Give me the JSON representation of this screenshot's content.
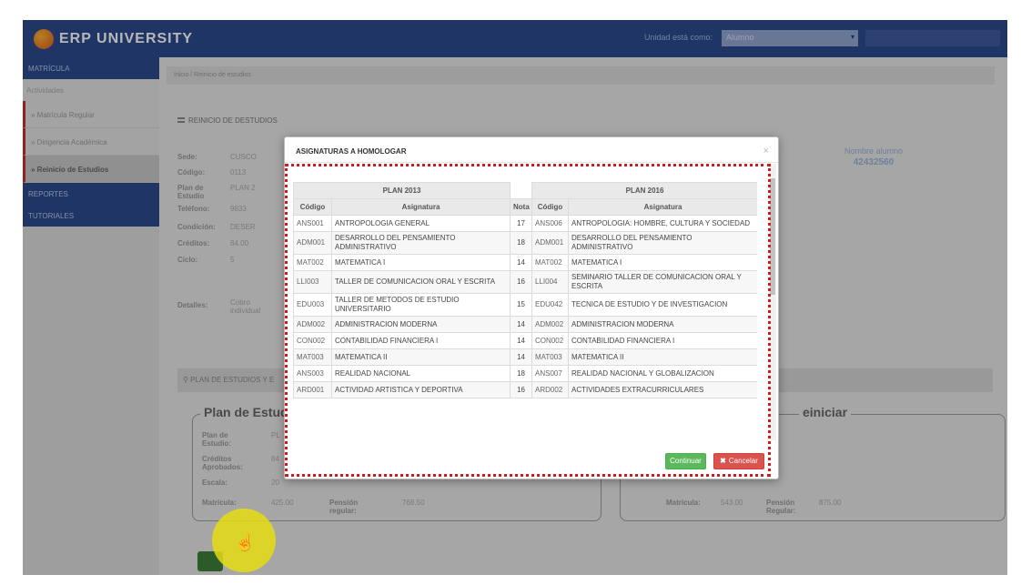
{
  "header": {
    "logo_text": "ERP UNIVERSITY",
    "logo_tag": "",
    "unit_label": "Unidad está como:",
    "unit_select_value": "Alumno",
    "colors": {
      "primary": "#2c4a8c",
      "accent": "#c9302c"
    }
  },
  "sidebar": {
    "section_matricula": "MATRÍCULA",
    "subsection": "Actividades",
    "items": [
      {
        "label": "» Matrícula Regular"
      },
      {
        "label": "» Dirigencia Académica"
      },
      {
        "label": "» Reinicio de Estudios"
      }
    ],
    "section_reportes": "REPORTES",
    "section_tutoriales": "TUTORIALES"
  },
  "main": {
    "breadcrumb": "Inicio  /  Reinicio de estudios",
    "page_title": "REINICIO DE DESTUDIOS",
    "fields": [
      {
        "label": "Sede:",
        "value": "CUSCO"
      },
      {
        "label": "Código:",
        "value": "0113"
      },
      {
        "label": "Plan de Estudio",
        "value": "PLAN 2"
      },
      {
        "label": "Teléfono:",
        "value": "9833"
      },
      {
        "label": "Condición:",
        "value": "DESER"
      },
      {
        "label": "Créditos:",
        "value": "84.00"
      },
      {
        "label": "Ciclo:",
        "value": "5"
      },
      {
        "label": "Detalles:",
        "value": "Cobro individual"
      }
    ],
    "alumno_label": "Nombre alumno",
    "alumno_dni": "42432560",
    "plan_bar": "PLAN DE ESTUDIOS Y E",
    "left_fieldset": {
      "legend": "Plan de Estud",
      "rows": [
        {
          "label": "Plan de Estudio:",
          "value": "PL"
        },
        {
          "label": "Créditos Aprobados:",
          "value": "84"
        },
        {
          "label": "Escala:",
          "value": "20"
        },
        {
          "label": "Matrícula:",
          "value": "425.00"
        }
      ],
      "pension_label": "Pensión regular:",
      "pension_value": "768.50"
    },
    "right_fieldset": {
      "legend": "einiciar",
      "matricula_label": "Matrícula:",
      "matricula_value": "543.00",
      "pension_label": "Pensión Regular:",
      "pension_value": "875.00"
    }
  },
  "modal": {
    "title": "ASIGNATURAS A HOMOLOGAR",
    "close": "×",
    "plan_left": "PLAN 2013",
    "plan_right": "PLAN 2016",
    "columns": [
      "Código",
      "Asignatura",
      "Nota",
      "Código",
      "Asignatura"
    ],
    "rows": [
      {
        "c1": "ANS001",
        "a1": "ANTROPOLOGIA GENERAL",
        "nota": "17",
        "c2": "ANS006",
        "a2": "ANTROPOLOGIA: HOMBRE, CULTURA Y SOCIEDAD"
      },
      {
        "c1": "ADM001",
        "a1": "DESARROLLO DEL PENSAMIENTO ADMINISTRATIVO",
        "nota": "18",
        "c2": "ADM001",
        "a2": "DESARROLLO DEL PENSAMIENTO ADMINISTRATIVO"
      },
      {
        "c1": "MAT002",
        "a1": "MATEMATICA I",
        "nota": "14",
        "c2": "MAT002",
        "a2": "MATEMATICA I"
      },
      {
        "c1": "LLI003",
        "a1": "TALLER DE COMUNICACION ORAL Y ESCRITA",
        "nota": "16",
        "c2": "LLI004",
        "a2": "SEMINARIO TALLER DE COMUNICACION ORAL Y ESCRITA"
      },
      {
        "c1": "EDU003",
        "a1": "TALLER DE METODOS DE ESTUDIO UNIVERSITARIO",
        "nota": "15",
        "c2": "EDU042",
        "a2": "TECNICA DE ESTUDIO Y DE INVESTIGACION"
      },
      {
        "c1": "ADM002",
        "a1": "ADMINISTRACION MODERNA",
        "nota": "14",
        "c2": "ADM002",
        "a2": "ADMINISTRACION MODERNA"
      },
      {
        "c1": "CON002",
        "a1": "CONTABILIDAD FINANCIERA I",
        "nota": "14",
        "c2": "CON002",
        "a2": "CONTABILIDAD FINANCIERA I"
      },
      {
        "c1": "MAT003",
        "a1": "MATEMATICA II",
        "nota": "14",
        "c2": "MAT003",
        "a2": "MATEMATICA II"
      },
      {
        "c1": "ANS003",
        "a1": "REALIDAD NACIONAL",
        "nota": "18",
        "c2": "ANS007",
        "a2": "REALIDAD NACIONAL Y GLOBALIZACION"
      },
      {
        "c1": "ARD001",
        "a1": "ACTIVIDAD ARTISTICA Y DEPORTIVA",
        "nota": "16",
        "c2": "ARD002",
        "a2": "ACTIVIDADES EXTRACURRICULARES"
      }
    ],
    "continue_label": "Continuar",
    "cancel_label": "Cancelar",
    "cancel_icon": "✖"
  }
}
